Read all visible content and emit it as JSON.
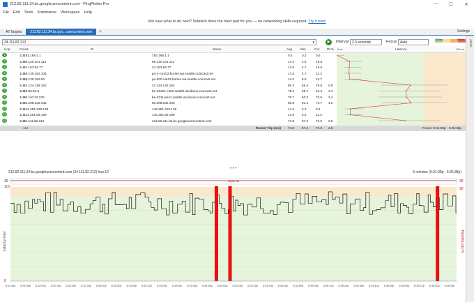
{
  "window": {
    "title": "212.82.111.34.bc.googleusercontent.com - PingPlotter Pro",
    "min": "—",
    "max": "☐",
    "close": "✕"
  },
  "menu": [
    "File",
    "Edit",
    "Tools",
    "Summaries",
    "Workspace",
    "Help"
  ],
  "banner": {
    "text": "Not sure what to do next? Sidekick does the hard part for you — no networking skills required.",
    "link": "Try it now!"
  },
  "tabs": {
    "all": "All Targets",
    "active": "212.82.111.34.bc.goo...usercontent.com",
    "add": "+",
    "settings": "Settings"
  },
  "toolbar": {
    "target": "34.111.82.212",
    "interval_label": "Interval",
    "interval": "2.5 seconds",
    "focus_label": "Focus",
    "focus": "Auto"
  },
  "legend": {
    "lo": "100ms",
    "hi": "200ms",
    "colors": [
      "#9ad49a",
      "#f4e29a",
      "#f4b06a",
      "#e46a6a"
    ]
  },
  "alerts_label": "Alerts",
  "columns": {
    "hop": "Hop",
    "count": "Count",
    "ip": "IP",
    "name": "Name",
    "avg": "Avg",
    "min": "Min",
    "cur": "Cur",
    "pl": "PL%",
    "lat0": "0 ms",
    "latency": "Latency",
    "lat140": "140 ms"
  },
  "hops": [
    {
      "hop": "1",
      "count": "118",
      "ip": "192.168.1.1",
      "name": "192.168.1.1",
      "avg": "0.5",
      "min": "0.2",
      "cur": "0.5",
      "pl": "",
      "plv": 0,
      "lat": 0.5
    },
    {
      "hop": "2",
      "count": "118",
      "ip": "96.120.101.113",
      "name": "96.120.101.113",
      "avg": "14.3",
      "min": "4.5",
      "cur": "15.5",
      "pl": "",
      "plv": 0,
      "lat": 14.3
    },
    {
      "hop": "3",
      "count": "118",
      "ip": "24.153.84.77",
      "name": "24.153.84.77",
      "avg": "13.6",
      "min": "4.7",
      "cur": "15.5",
      "pl": "",
      "plv": 0,
      "lat": 13.6
    },
    {
      "hop": "4",
      "count": "118",
      "ip": "69.139.162.106",
      "name": "po-2-rur202.burien.wa.seattle.comcast.net",
      "avg": "13.5",
      "min": "4.7",
      "cur": "11.3",
      "pl": "",
      "plv": 0,
      "lat": 13.5
    },
    {
      "hop": "5",
      "count": "118",
      "ip": "68.139.162.53",
      "name": "po-200-xar02.burien.wa.seattle.comcast.net",
      "avg": "14.2",
      "min": "5.0",
      "cur": "12.7",
      "pl": "",
      "plv": 0,
      "lat": 14.2
    },
    {
      "hop": "6",
      "count": "118",
      "ip": "24.124.128.162",
      "name": "24.124.128.162",
      "avg": "80.3",
      "min": "68.4",
      "cur": "79.8",
      "pl": "0.8",
      "plv": 0.8,
      "lat": 80.3
    },
    {
      "hop": "7",
      "count": "118",
      "ip": "68.86.93.5",
      "name": "be-36121-cs02.seattle.wa.ibone.comcast.net",
      "avg": "75.4",
      "min": "59.7",
      "cur": "64.4",
      "pl": "3.4",
      "plv": 3.4,
      "lat": 75.4
    },
    {
      "hop": "8",
      "count": "118",
      "ip": "96.110.33.230",
      "name": "be-2211-pe11.seattle.wa.ibone.comcast.net",
      "avg": "75.7",
      "min": "60.3",
      "cur": "73.5",
      "pl": "3.4",
      "plv": 3.4,
      "lat": 75.7
    },
    {
      "hop": "9",
      "count": "118",
      "ip": "50.208.232.346",
      "name": "50.208.232.346",
      "avg": "80.8",
      "min": "61.3",
      "cur": "73.7",
      "pl": "4.2",
      "plv": 4.2,
      "lat": 80.8
    },
    {
      "hop": "10",
      "count": "118",
      "ip": "142.251.229.139",
      "name": "142.251.229.139",
      "avg": "14.6",
      "min": "6.3",
      "cur": "9.6",
      "pl": "",
      "plv": 0,
      "lat": 14.6
    },
    {
      "hop": "11",
      "count": "118",
      "ip": "142.251.55.199",
      "name": "142.251.55.199",
      "avg": "14.6",
      "min": "5.2",
      "cur": "11.3",
      "pl": "",
      "plv": 0,
      "lat": 14.6
    },
    {
      "hop": "12",
      "count": "118",
      "ip": "34.111.82.212",
      "name": "212.82.111.34.bc.googleusercontent.com",
      "avg": "74.8",
      "min": "57.2",
      "cur": "72.5",
      "pl": "2.5",
      "plv": 2.5,
      "lat": 74.8
    }
  ],
  "summary": {
    "count": "118",
    "label": "Round Trip (ms)",
    "avg": "74.8",
    "min": "57.2",
    "cur": "72.5",
    "pl": "2.5",
    "focus": "Focus: 6:31:08p - 6:36:38p"
  },
  "graph": {
    "title": "212.82.111.34.bc.googleusercontent.com (34.111.82.212) hop 12",
    "range": "5 minutes (6:31:08p - 6:36:38p)",
    "y_label": "Latency (ms)",
    "pl_label": "Packet Loss %",
    "y_max": "110",
    "y_zero": "0",
    "pl_top": "30",
    "pl_top2": "35",
    "pl_scale": "30",
    "top_marker": "25|ms 110",
    "times": [
      "6:31:40p",
      "6:31:50p",
      "6:32:00p",
      "6:32:10p",
      "6:32:20p",
      "6:32:30p",
      "6:32:40p",
      "6:32:50p",
      "6:33:00p",
      "6:33:10p",
      "6:33:20p",
      "6:33:30p",
      "6:33:40p",
      "6:33:50p",
      "6:34:00p",
      "6:34:10p",
      "6:34:20p",
      "6:34:30p",
      "6:34:40p",
      "6:34:50p",
      "6:35:00p",
      "6:35:10p",
      "6:35:20p",
      "6:35:30p",
      "6:35:40p",
      "6:35:50p",
      "6:36:00p",
      "6:36:10p",
      "6:36:20p",
      "6:36:30p"
    ],
    "loss_times": [
      "6:33:56p",
      "6:34:05p",
      "6:36:22p"
    ]
  }
}
